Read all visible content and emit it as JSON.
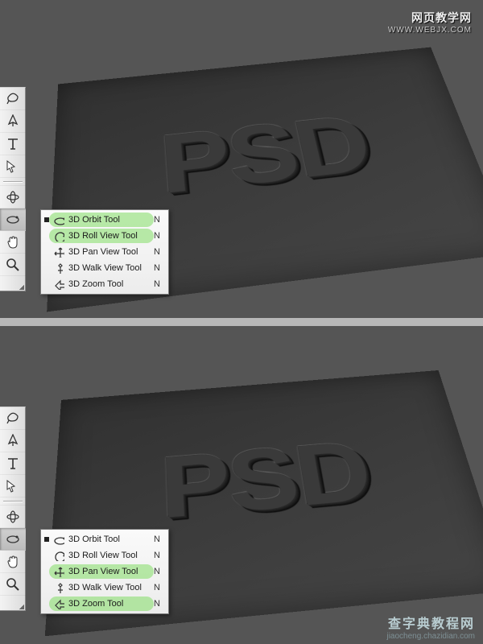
{
  "watermark_top": {
    "line1": "网页教学网",
    "line2": "WWW.WEBJX.COM"
  },
  "watermark_bottom": {
    "line1": "查字典教程网",
    "line2": "jiaocheng.chazidian.com"
  },
  "text3d": "PSD",
  "toolbar": {
    "tools": [
      "lasso",
      "pen",
      "type",
      "path-select",
      "divider",
      "3d-rotate",
      "3d-orbit",
      "hand",
      "zoom"
    ]
  },
  "flyout_top": {
    "items": [
      {
        "label": "3D Orbit Tool",
        "key": "N",
        "icon": "orbit",
        "current": true,
        "highlight": true
      },
      {
        "label": "3D Roll View Tool",
        "key": "N",
        "icon": "roll",
        "current": false,
        "highlight": true
      },
      {
        "label": "3D Pan View Tool",
        "key": "N",
        "icon": "pan",
        "current": false,
        "highlight": false
      },
      {
        "label": "3D Walk View Tool",
        "key": "N",
        "icon": "walk",
        "current": false,
        "highlight": false
      },
      {
        "label": "3D Zoom Tool",
        "key": "N",
        "icon": "zoom3d",
        "current": false,
        "highlight": false
      }
    ]
  },
  "flyout_bottom": {
    "items": [
      {
        "label": "3D Orbit Tool",
        "key": "N",
        "icon": "orbit",
        "current": true,
        "highlight": false
      },
      {
        "label": "3D Roll View Tool",
        "key": "N",
        "icon": "roll",
        "current": false,
        "highlight": false
      },
      {
        "label": "3D Pan View Tool",
        "key": "N",
        "icon": "pan",
        "current": false,
        "highlight": true
      },
      {
        "label": "3D Walk View Tool",
        "key": "N",
        "icon": "walk",
        "current": false,
        "highlight": false
      },
      {
        "label": "3D Zoom Tool",
        "key": "N",
        "icon": "zoom3d",
        "current": false,
        "highlight": true
      }
    ]
  }
}
